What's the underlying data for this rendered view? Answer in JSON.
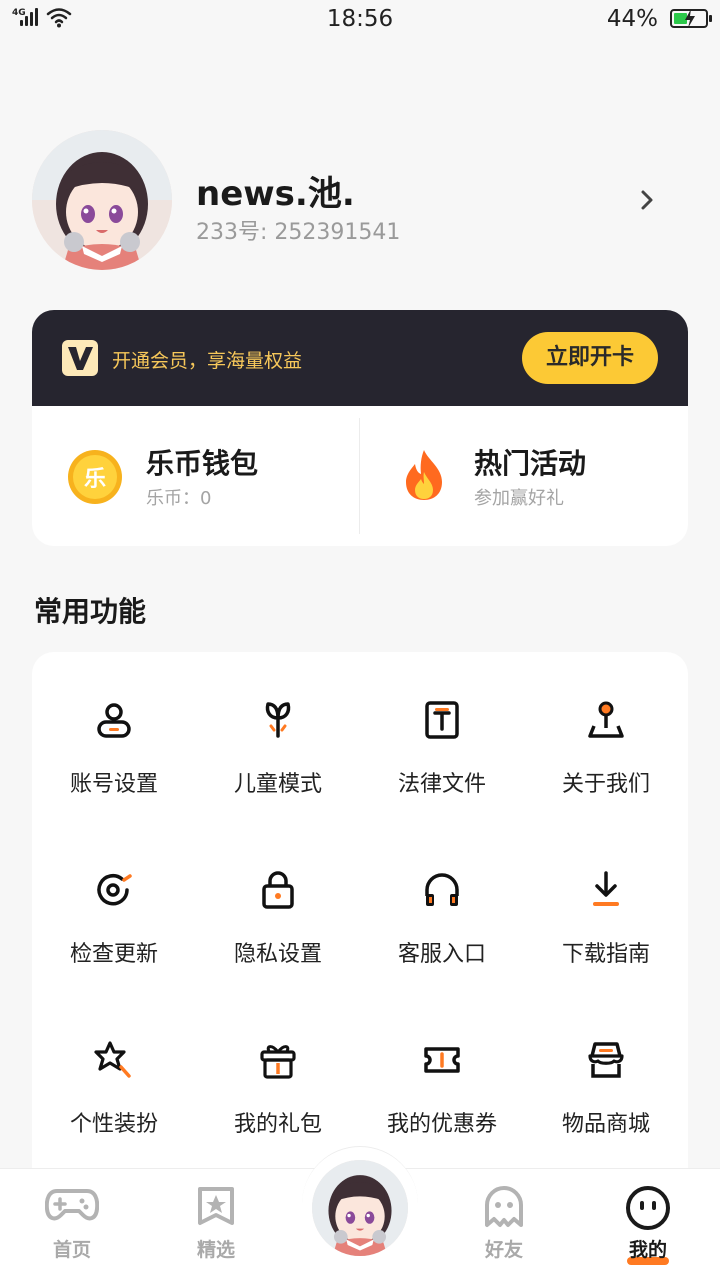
{
  "status_bar": {
    "network": "4G",
    "time": "18:56",
    "battery": "44%",
    "battery_level": 0.44
  },
  "profile": {
    "username": "news.池.",
    "uid": "233号: 252391541"
  },
  "vip": {
    "text": "开通会员，享海量权益",
    "button": "立即开卡",
    "accent": "#fcc935"
  },
  "wallet": {
    "title": "乐币钱包",
    "balance": "乐币：0",
    "coin_glyph": "乐"
  },
  "activity": {
    "title": "热门活动",
    "subtitle": "参加赢好礼"
  },
  "functions": {
    "title": "常用功能",
    "items": [
      {
        "label": "账号设置",
        "icon": "user-icon"
      },
      {
        "label": "儿童模式",
        "icon": "sprout-icon"
      },
      {
        "label": "法律文件",
        "icon": "document-icon"
      },
      {
        "label": "关于我们",
        "icon": "pin-icon"
      },
      {
        "label": "检查更新",
        "icon": "refresh-icon"
      },
      {
        "label": "隐私设置",
        "icon": "lock-icon"
      },
      {
        "label": "客服入口",
        "icon": "headset-icon"
      },
      {
        "label": "下载指南",
        "icon": "download-icon"
      },
      {
        "label": "个性装扮",
        "icon": "magic-icon"
      },
      {
        "label": "我的礼包",
        "icon": "gift-icon"
      },
      {
        "label": "我的优惠券",
        "icon": "ticket-icon"
      },
      {
        "label": "物品商城",
        "icon": "store-icon"
      }
    ]
  },
  "tabs": [
    {
      "label": "首页",
      "icon": "gamepad-icon"
    },
    {
      "label": "精选",
      "icon": "star-icon"
    },
    {
      "label": "好友",
      "icon": "ghost-icon"
    },
    {
      "label": "我的",
      "icon": "face-icon"
    }
  ],
  "colors": {
    "orange": "#ff7a22",
    "dark": "#26252f"
  }
}
